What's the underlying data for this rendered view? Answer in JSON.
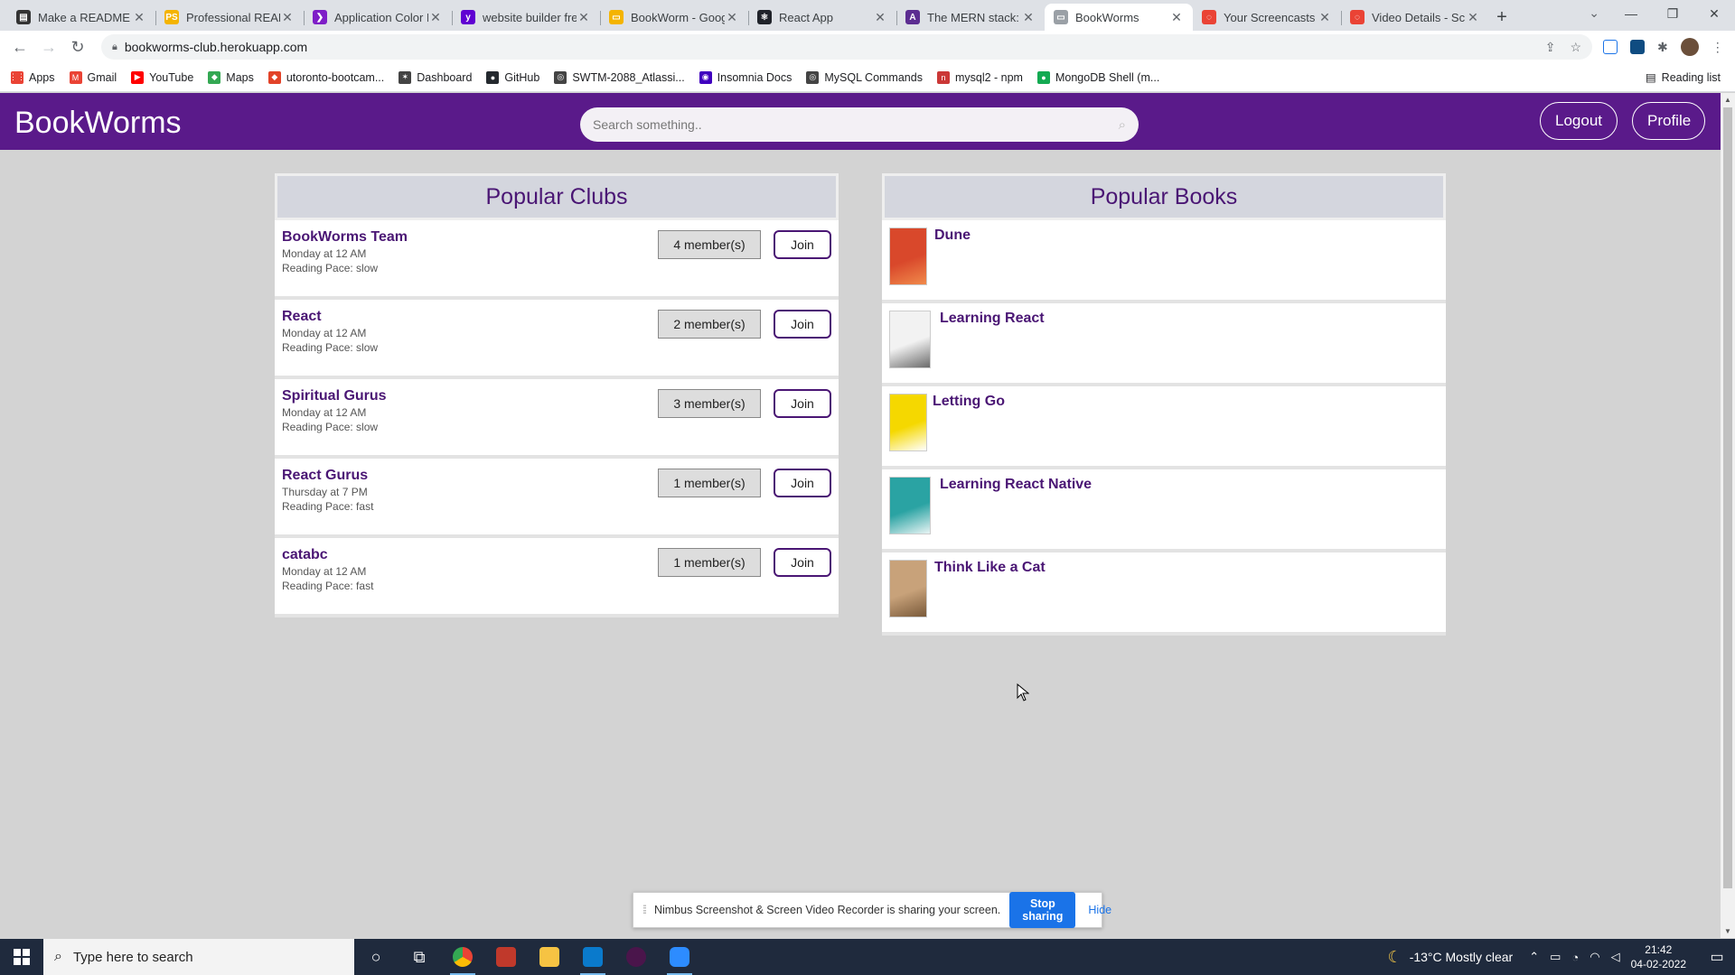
{
  "browser": {
    "tabs": [
      {
        "title": "Make a README",
        "fav_color": "#333333",
        "fav_glyph": "▤",
        "active": false
      },
      {
        "title": "Professional READI",
        "fav_color": "#f4b400",
        "fav_glyph": "PS",
        "active": false
      },
      {
        "title": "Application Color I",
        "fav_color": "#7e1ec7",
        "fav_glyph": "❯",
        "active": false
      },
      {
        "title": "website builder fre",
        "fav_color": "#6001d2",
        "fav_glyph": "y",
        "active": false
      },
      {
        "title": "BookWorm - Goog",
        "fav_color": "#f4b400",
        "fav_glyph": "▭",
        "active": false
      },
      {
        "title": "React App",
        "fav_color": "#20232a",
        "fav_glyph": "⚛",
        "active": false
      },
      {
        "title": "The MERN stack: A",
        "fav_color": "#5c2d91",
        "fav_glyph": "A",
        "active": false
      },
      {
        "title": "BookWorms",
        "fav_color": "#9aa0a6",
        "fav_glyph": "▭",
        "active": true
      },
      {
        "title": "Your Screencasts -",
        "fav_color": "#ea4335",
        "fav_glyph": "◌",
        "active": false
      },
      {
        "title": "Video Details - Scr",
        "fav_color": "#ea4335",
        "fav_glyph": "◌",
        "active": false
      }
    ],
    "url": "bookworms-club.herokuapp.com",
    "bookmarks": [
      {
        "label": "Apps",
        "color": "#ea4335",
        "glyph": "⋮⋮"
      },
      {
        "label": "Gmail",
        "color": "#ea4335",
        "glyph": "M"
      },
      {
        "label": "YouTube",
        "color": "#ff0000",
        "glyph": "▶"
      },
      {
        "label": "Maps",
        "color": "#34a853",
        "glyph": "◆"
      },
      {
        "label": "utoronto-bootcam...",
        "color": "#e24329",
        "glyph": "◆"
      },
      {
        "label": "Dashboard",
        "color": "#444444",
        "glyph": "✶"
      },
      {
        "label": "GitHub",
        "color": "#24292e",
        "glyph": "●"
      },
      {
        "label": "SWTM-2088_Atlassi...",
        "color": "#444444",
        "glyph": "◎"
      },
      {
        "label": "Insomnia Docs",
        "color": "#4000bf",
        "glyph": "◉"
      },
      {
        "label": "MySQL Commands",
        "color": "#444444",
        "glyph": "◎"
      },
      {
        "label": "mysql2 - npm",
        "color": "#cb3837",
        "glyph": "n"
      },
      {
        "label": "MongoDB Shell (m...",
        "color": "#13aa52",
        "glyph": "●"
      }
    ],
    "reading_list": "Reading list"
  },
  "app": {
    "brand": "BookWorms",
    "search_placeholder": "Search something..",
    "logout_label": "Logout",
    "profile_label": "Profile",
    "accent_color": "#5a1a8a",
    "clubs_heading": "Popular Clubs",
    "books_heading": "Popular Books",
    "clubs": [
      {
        "name": "BookWorms Team",
        "time": "Monday at 12 AM",
        "pace": "Reading Pace: slow",
        "members": "4 member(s)",
        "join": "Join"
      },
      {
        "name": "React",
        "time": "Monday at 12 AM",
        "pace": "Reading Pace: slow",
        "members": "2 member(s)",
        "join": "Join"
      },
      {
        "name": "Spiritual Gurus",
        "time": "Monday at 12 AM",
        "pace": "Reading Pace: slow",
        "members": "3 member(s)",
        "join": "Join"
      },
      {
        "name": "React Gurus",
        "time": "Thursday at 7 PM",
        "pace": "Reading Pace: fast",
        "members": "1 member(s)",
        "join": "Join"
      },
      {
        "name": "catabc",
        "time": "Monday at 12 AM",
        "pace": "Reading Pace: fast",
        "members": "1 member(s)",
        "join": "Join"
      }
    ],
    "books": [
      {
        "title": "Dune",
        "cover_color": "#d9482b",
        "cover_accent": "#f08a4b"
      },
      {
        "title": "Learning React",
        "cover_color": "#f2f2f2",
        "cover_accent": "#6b6b6b"
      },
      {
        "title": "Letting Go",
        "cover_color": "#f5d800",
        "cover_accent": "#ffffff"
      },
      {
        "title": "Learning React Native",
        "cover_color": "#2aa3a3",
        "cover_accent": "#e8f4f4"
      },
      {
        "title": "Think Like a Cat",
        "cover_color": "#c8a27a",
        "cover_accent": "#7a5a3a"
      }
    ]
  },
  "share_bar": {
    "message": "Nimbus Screenshot & Screen Video Recorder is sharing your screen.",
    "stop_label": "Stop sharing",
    "hide_label": "Hide"
  },
  "taskbar": {
    "search_placeholder": "Type here to search",
    "weather": "-13°C  Mostly clear",
    "time": "21:42",
    "date": "04-02-2022"
  }
}
